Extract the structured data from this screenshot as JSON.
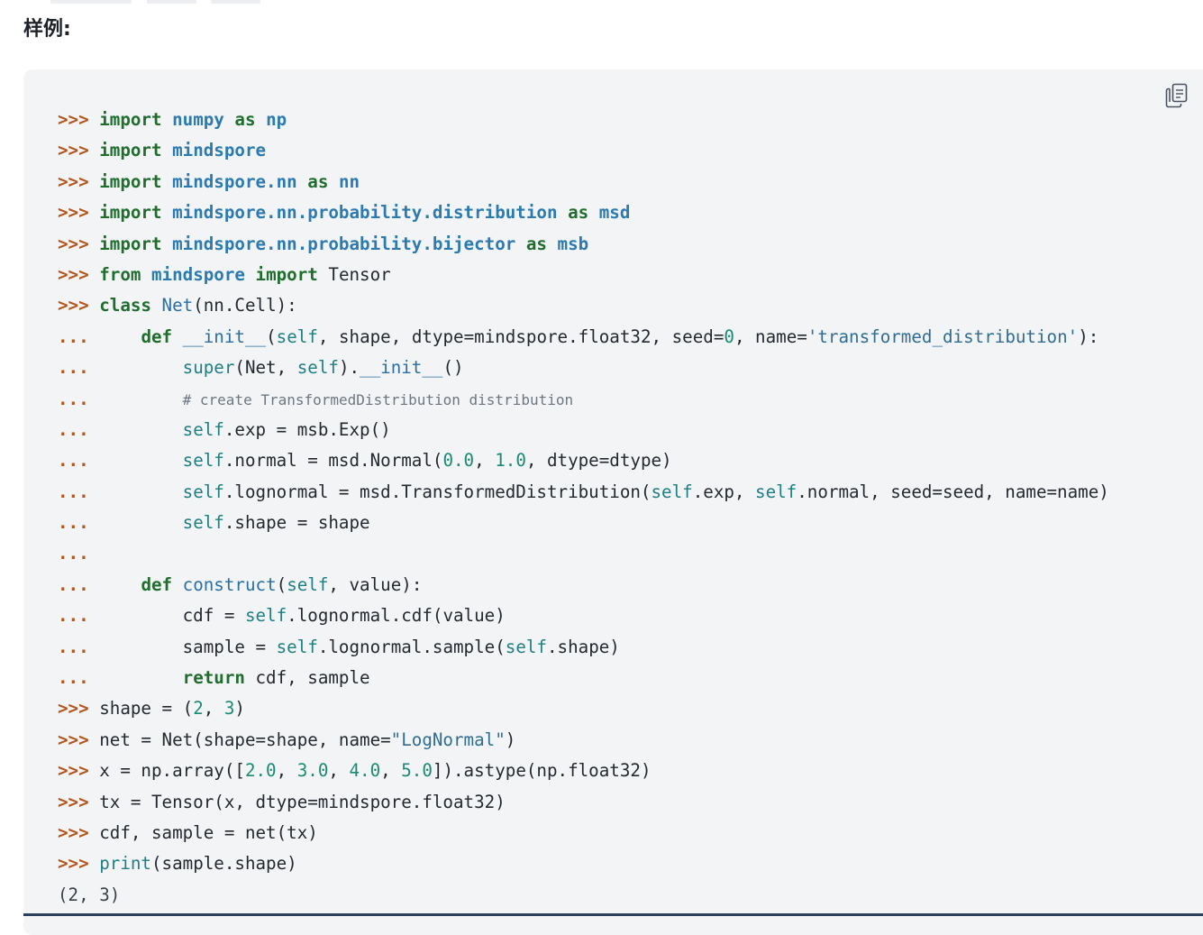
{
  "section": {
    "title": "样例:"
  },
  "toolbar": {
    "copy_icon": "copy-icon"
  },
  "code": {
    "language": "python",
    "lines": [
      [
        {
          "t": "prompt",
          "v": ">>> "
        },
        {
          "t": "kw",
          "v": "import"
        },
        {
          "t": "plain",
          "v": " "
        },
        {
          "t": "mod",
          "v": "numpy"
        },
        {
          "t": "plain",
          "v": " "
        },
        {
          "t": "kw",
          "v": "as"
        },
        {
          "t": "plain",
          "v": " "
        },
        {
          "t": "mod",
          "v": "np"
        }
      ],
      [
        {
          "t": "prompt",
          "v": ">>> "
        },
        {
          "t": "kw",
          "v": "import"
        },
        {
          "t": "plain",
          "v": " "
        },
        {
          "t": "mod",
          "v": "mindspore"
        }
      ],
      [
        {
          "t": "prompt",
          "v": ">>> "
        },
        {
          "t": "kw",
          "v": "import"
        },
        {
          "t": "plain",
          "v": " "
        },
        {
          "t": "mod",
          "v": "mindspore.nn"
        },
        {
          "t": "plain",
          "v": " "
        },
        {
          "t": "kw",
          "v": "as"
        },
        {
          "t": "plain",
          "v": " "
        },
        {
          "t": "mod",
          "v": "nn"
        }
      ],
      [
        {
          "t": "prompt",
          "v": ">>> "
        },
        {
          "t": "kw",
          "v": "import"
        },
        {
          "t": "plain",
          "v": " "
        },
        {
          "t": "mod",
          "v": "mindspore.nn.probability.distribution"
        },
        {
          "t": "plain",
          "v": " "
        },
        {
          "t": "kw",
          "v": "as"
        },
        {
          "t": "plain",
          "v": " "
        },
        {
          "t": "mod",
          "v": "msd"
        }
      ],
      [
        {
          "t": "prompt",
          "v": ">>> "
        },
        {
          "t": "kw",
          "v": "import"
        },
        {
          "t": "plain",
          "v": " "
        },
        {
          "t": "mod",
          "v": "mindspore.nn.probability.bijector"
        },
        {
          "t": "plain",
          "v": " "
        },
        {
          "t": "kw",
          "v": "as"
        },
        {
          "t": "plain",
          "v": " "
        },
        {
          "t": "mod",
          "v": "msb"
        }
      ],
      [
        {
          "t": "prompt",
          "v": ">>> "
        },
        {
          "t": "kw",
          "v": "from"
        },
        {
          "t": "plain",
          "v": " "
        },
        {
          "t": "mod",
          "v": "mindspore"
        },
        {
          "t": "plain",
          "v": " "
        },
        {
          "t": "kw",
          "v": "import"
        },
        {
          "t": "plain",
          "v": " Tensor"
        }
      ],
      [
        {
          "t": "prompt",
          "v": ">>> "
        },
        {
          "t": "kw",
          "v": "class"
        },
        {
          "t": "plain",
          "v": " "
        },
        {
          "t": "fn",
          "v": "Net"
        },
        {
          "t": "plain",
          "v": "(nn.Cell):"
        }
      ],
      [
        {
          "t": "prompt",
          "v": "... "
        },
        {
          "t": "plain",
          "v": "    "
        },
        {
          "t": "kw",
          "v": "def"
        },
        {
          "t": "plain",
          "v": " "
        },
        {
          "t": "fn",
          "v": "__init__"
        },
        {
          "t": "plain",
          "v": "("
        },
        {
          "t": "slf",
          "v": "self"
        },
        {
          "t": "plain",
          "v": ", shape, dtype=mindspore.float32, seed="
        },
        {
          "t": "num",
          "v": "0"
        },
        {
          "t": "plain",
          "v": ", name="
        },
        {
          "t": "str",
          "v": "'transformed_distribution'"
        },
        {
          "t": "plain",
          "v": "):"
        }
      ],
      [
        {
          "t": "prompt",
          "v": "... "
        },
        {
          "t": "plain",
          "v": "        "
        },
        {
          "t": "slf",
          "v": "super"
        },
        {
          "t": "plain",
          "v": "(Net, "
        },
        {
          "t": "slf",
          "v": "self"
        },
        {
          "t": "plain",
          "v": ")."
        },
        {
          "t": "fn",
          "v": "__init__"
        },
        {
          "t": "plain",
          "v": "()"
        }
      ],
      [
        {
          "t": "prompt",
          "v": "... "
        },
        {
          "t": "plain",
          "v": "        "
        },
        {
          "t": "cmt",
          "v": "# create TransformedDistribution distribution"
        }
      ],
      [
        {
          "t": "prompt",
          "v": "... "
        },
        {
          "t": "plain",
          "v": "        "
        },
        {
          "t": "slf",
          "v": "self"
        },
        {
          "t": "plain",
          "v": ".exp = msb.Exp()"
        }
      ],
      [
        {
          "t": "prompt",
          "v": "... "
        },
        {
          "t": "plain",
          "v": "        "
        },
        {
          "t": "slf",
          "v": "self"
        },
        {
          "t": "plain",
          "v": ".normal = msd.Normal("
        },
        {
          "t": "num",
          "v": "0.0"
        },
        {
          "t": "plain",
          "v": ", "
        },
        {
          "t": "num",
          "v": "1.0"
        },
        {
          "t": "plain",
          "v": ", dtype=dtype)"
        }
      ],
      [
        {
          "t": "prompt",
          "v": "... "
        },
        {
          "t": "plain",
          "v": "        "
        },
        {
          "t": "slf",
          "v": "self"
        },
        {
          "t": "plain",
          "v": ".lognormal = msd.TransformedDistribution("
        },
        {
          "t": "slf",
          "v": "self"
        },
        {
          "t": "plain",
          "v": ".exp, "
        },
        {
          "t": "slf",
          "v": "self"
        },
        {
          "t": "plain",
          "v": ".normal, seed=seed, name=name)"
        }
      ],
      [
        {
          "t": "prompt",
          "v": "... "
        },
        {
          "t": "plain",
          "v": "        "
        },
        {
          "t": "slf",
          "v": "self"
        },
        {
          "t": "plain",
          "v": ".shape = shape"
        }
      ],
      [
        {
          "t": "prompt",
          "v": "... "
        }
      ],
      [
        {
          "t": "prompt",
          "v": "... "
        },
        {
          "t": "plain",
          "v": "    "
        },
        {
          "t": "kw",
          "v": "def"
        },
        {
          "t": "plain",
          "v": " "
        },
        {
          "t": "fn",
          "v": "construct"
        },
        {
          "t": "plain",
          "v": "("
        },
        {
          "t": "slf",
          "v": "self"
        },
        {
          "t": "plain",
          "v": ", value):"
        }
      ],
      [
        {
          "t": "prompt",
          "v": "... "
        },
        {
          "t": "plain",
          "v": "        cdf = "
        },
        {
          "t": "slf",
          "v": "self"
        },
        {
          "t": "plain",
          "v": ".lognormal.cdf(value)"
        }
      ],
      [
        {
          "t": "prompt",
          "v": "... "
        },
        {
          "t": "plain",
          "v": "        sample = "
        },
        {
          "t": "slf",
          "v": "self"
        },
        {
          "t": "plain",
          "v": ".lognormal.sample("
        },
        {
          "t": "slf",
          "v": "self"
        },
        {
          "t": "plain",
          "v": ".shape)"
        }
      ],
      [
        {
          "t": "prompt",
          "v": "... "
        },
        {
          "t": "plain",
          "v": "        "
        },
        {
          "t": "kw",
          "v": "return"
        },
        {
          "t": "plain",
          "v": " cdf, sample"
        }
      ],
      [
        {
          "t": "prompt",
          "v": ">>> "
        },
        {
          "t": "plain",
          "v": "shape = ("
        },
        {
          "t": "num",
          "v": "2"
        },
        {
          "t": "plain",
          "v": ", "
        },
        {
          "t": "num",
          "v": "3"
        },
        {
          "t": "plain",
          "v": ")"
        }
      ],
      [
        {
          "t": "prompt",
          "v": ">>> "
        },
        {
          "t": "plain",
          "v": "net = Net(shape=shape, name="
        },
        {
          "t": "str",
          "v": "\"LogNormal\""
        },
        {
          "t": "plain",
          "v": ")"
        }
      ],
      [
        {
          "t": "prompt",
          "v": ">>> "
        },
        {
          "t": "plain",
          "v": "x = np.array(["
        },
        {
          "t": "num",
          "v": "2.0"
        },
        {
          "t": "plain",
          "v": ", "
        },
        {
          "t": "num",
          "v": "3.0"
        },
        {
          "t": "plain",
          "v": ", "
        },
        {
          "t": "num",
          "v": "4.0"
        },
        {
          "t": "plain",
          "v": ", "
        },
        {
          "t": "num",
          "v": "5.0"
        },
        {
          "t": "plain",
          "v": "]).astype(np.float32)"
        }
      ],
      [
        {
          "t": "prompt",
          "v": ">>> "
        },
        {
          "t": "plain",
          "v": "tx = Tensor(x, dtype=mindspore.float32)"
        }
      ],
      [
        {
          "t": "prompt",
          "v": ">>> "
        },
        {
          "t": "plain",
          "v": "cdf, sample = net(tx)"
        }
      ],
      [
        {
          "t": "prompt",
          "v": ">>> "
        },
        {
          "t": "slf",
          "v": "print"
        },
        {
          "t": "plain",
          "v": "(sample.shape)"
        }
      ],
      [
        {
          "t": "output",
          "v": "(2, 3)"
        }
      ]
    ]
  }
}
